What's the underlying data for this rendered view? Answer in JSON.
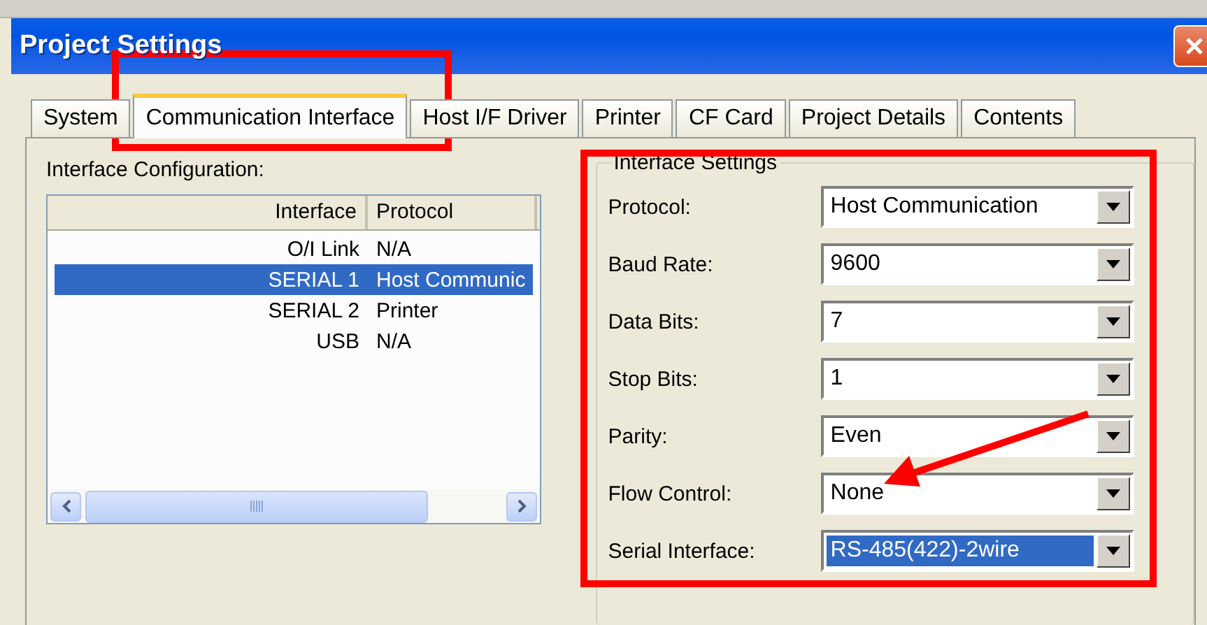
{
  "window": {
    "title": "Project Settings"
  },
  "tabs": [
    {
      "label": "System",
      "selected": false
    },
    {
      "label": "Communication Interface",
      "selected": true
    },
    {
      "label": "Host I/F Driver",
      "selected": false
    },
    {
      "label": "Printer",
      "selected": false
    },
    {
      "label": "CF Card",
      "selected": false
    },
    {
      "label": "Project Details",
      "selected": false
    },
    {
      "label": "Contents",
      "selected": false
    }
  ],
  "interface_configuration": {
    "label": "Interface Configuration:",
    "columns": [
      "Interface",
      "Protocol"
    ],
    "rows": [
      {
        "interface": "O/I Link",
        "protocol": "N/A",
        "selected": false
      },
      {
        "interface": "SERIAL 1",
        "protocol": "Host Communic",
        "selected": true
      },
      {
        "interface": "SERIAL 2",
        "protocol": "Printer",
        "selected": false
      },
      {
        "interface": "USB",
        "protocol": "N/A",
        "selected": false
      }
    ]
  },
  "interface_settings": {
    "title": "Interface Settings",
    "fields": [
      {
        "label": "Protocol:",
        "value": "Host Communication",
        "selected": false
      },
      {
        "label": "Baud Rate:",
        "value": "9600",
        "selected": false
      },
      {
        "label": "Data Bits:",
        "value": "7",
        "selected": false
      },
      {
        "label": "Stop Bits:",
        "value": "1",
        "selected": false
      },
      {
        "label": "Parity:",
        "value": "Even",
        "selected": false
      },
      {
        "label": "Flow Control:",
        "value": "None",
        "selected": false
      },
      {
        "label": "Serial Interface:",
        "value": "RS-485(422)-2wire",
        "selected": true
      }
    ]
  },
  "annotations": [
    {
      "kind": "box"
    },
    {
      "kind": "box"
    },
    {
      "kind": "arrow"
    }
  ]
}
